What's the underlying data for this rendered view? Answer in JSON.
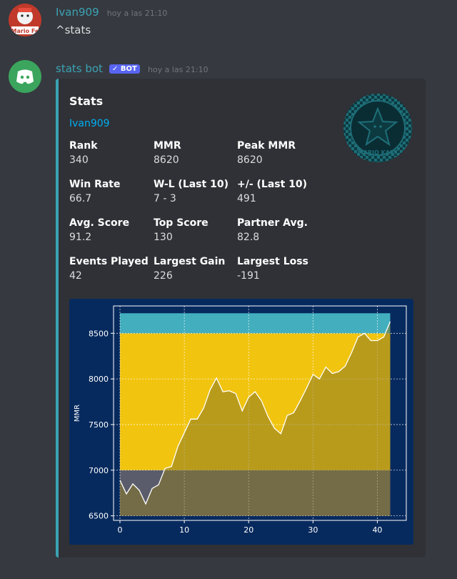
{
  "message1": {
    "author": "Ivan909",
    "author_color": "#3ba3b5",
    "timestamp": "hoy a las 21:10",
    "text": "^stats",
    "avatar_text": "Mario Fe"
  },
  "message2": {
    "author": "stats bot",
    "author_color": "#3ba3b5",
    "badge": "✓ BOT",
    "timestamp": "hoy a las 21:10",
    "avatar_icon": "discord-logo-icon"
  },
  "embed": {
    "accent_color": "#3ba3b5",
    "title": "Stats",
    "description": "Ivan909",
    "thumbnail_text": "MARIO KART",
    "fields": [
      {
        "name": "Rank",
        "value": "340"
      },
      {
        "name": "MMR",
        "value": "8620"
      },
      {
        "name": "Peak MMR",
        "value": "8620"
      },
      {
        "name": "Win Rate",
        "value": "66.7"
      },
      {
        "name": "W-L (Last 10)",
        "value": "7 - 3"
      },
      {
        "name": "+/- (Last 10)",
        "value": "491"
      },
      {
        "name": "Avg. Score",
        "value": "91.2"
      },
      {
        "name": "Top Score",
        "value": "130"
      },
      {
        "name": "Partner Avg.",
        "value": "82.8"
      },
      {
        "name": "Events Played",
        "value": "42"
      },
      {
        "name": "Largest Gain",
        "value": "226"
      },
      {
        "name": "Largest Loss",
        "value": "-191"
      }
    ]
  },
  "chart_data": {
    "type": "area",
    "xlabel": "",
    "ylabel": "MMR",
    "xlim": [
      -1,
      44.5
    ],
    "ylim": [
      6450,
      8800
    ],
    "xticks": [
      0,
      10,
      20,
      30,
      40
    ],
    "yticks": [
      6500,
      7000,
      7500,
      8000,
      8500
    ],
    "grid": true,
    "bands": [
      {
        "from": 6500,
        "to": 7000,
        "color": "#5a5c6c"
      },
      {
        "from": 7000,
        "to": 8500,
        "color": "#f1c40f"
      },
      {
        "from": 8500,
        "to": 8720,
        "color": "#42aebe"
      }
    ],
    "x": [
      0,
      1,
      2,
      3,
      4,
      5,
      6,
      7,
      8,
      9,
      10,
      11,
      12,
      13,
      14,
      15,
      16,
      17,
      18,
      19,
      20,
      21,
      22,
      23,
      24,
      25,
      26,
      27,
      28,
      29,
      30,
      31,
      32,
      33,
      34,
      35,
      36,
      37,
      38,
      39,
      40,
      41,
      42
    ],
    "y": [
      6890,
      6740,
      6850,
      6780,
      6630,
      6800,
      6840,
      7020,
      7040,
      7260,
      7410,
      7560,
      7560,
      7680,
      7880,
      8010,
      7860,
      7870,
      7840,
      7650,
      7800,
      7860,
      7760,
      7590,
      7460,
      7400,
      7600,
      7630,
      7760,
      7900,
      8050,
      8000,
      8130,
      8060,
      8080,
      8140,
      8290,
      8460,
      8500,
      8420,
      8420,
      8460,
      8630
    ],
    "colors": {
      "background": "#072a5e",
      "plot_background": "#072a5e",
      "line": "#ffffff",
      "fill": "#8a7a28",
      "axis_text": "#ffffff"
    }
  }
}
